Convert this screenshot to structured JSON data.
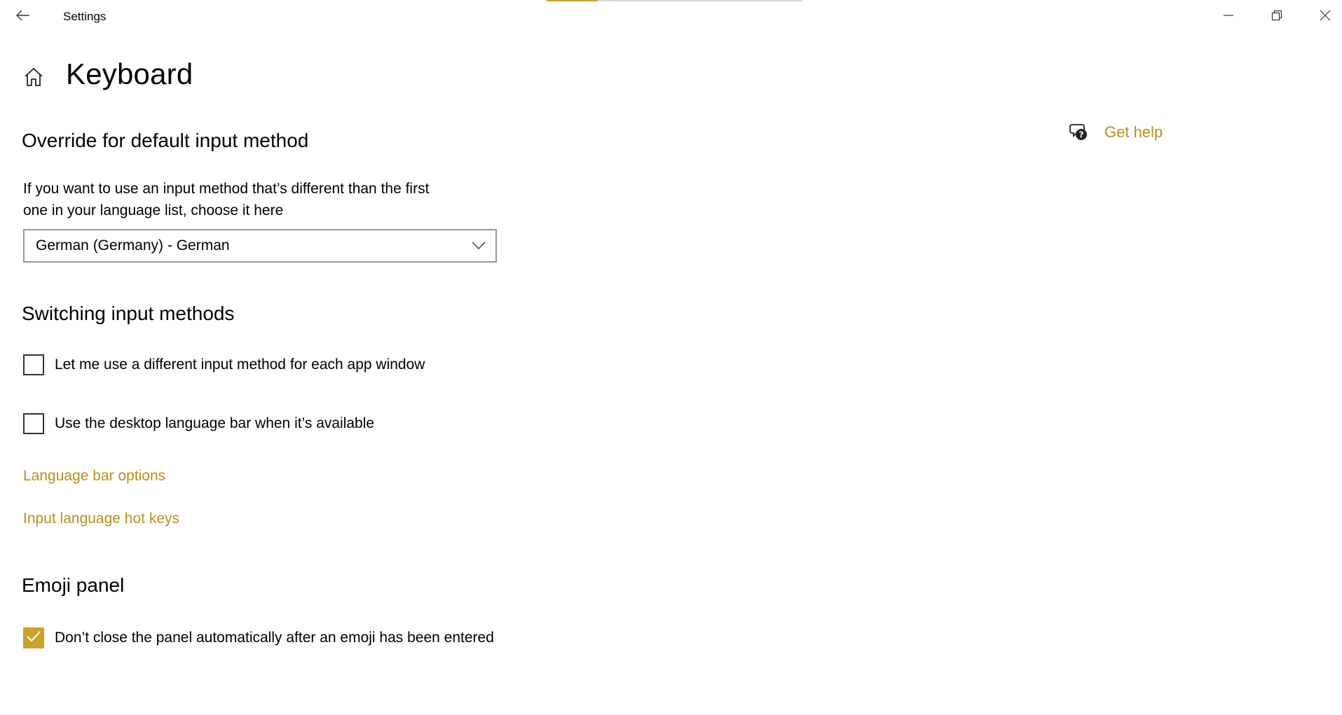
{
  "window": {
    "title": "Settings",
    "loading_progress": 0.2
  },
  "page": {
    "title": "Keyboard"
  },
  "help": {
    "label": "Get help"
  },
  "override_section": {
    "title": "Override for default input method",
    "description_line1": "If you want to use an input method that’s different than the first",
    "description_line2": "one in your language list, choose it here",
    "selected_value": "German (Germany) - German"
  },
  "switching_section": {
    "title": "Switching input methods",
    "checkbox_per_app": {
      "label": "Let me use a different input method for each app window",
      "checked": false
    },
    "checkbox_desktop_bar": {
      "label": "Use the desktop language bar when it’s available",
      "checked": false
    },
    "link_language_bar_options": "Language bar options",
    "link_hot_keys": "Input language hot keys"
  },
  "emoji_section": {
    "title": "Emoji panel",
    "checkbox_dont_close": {
      "label": "Don’t close the panel automatically after an emoji has been entered",
      "checked": true
    }
  },
  "colors": {
    "accent": "#c9a227",
    "link": "#b8901a"
  }
}
